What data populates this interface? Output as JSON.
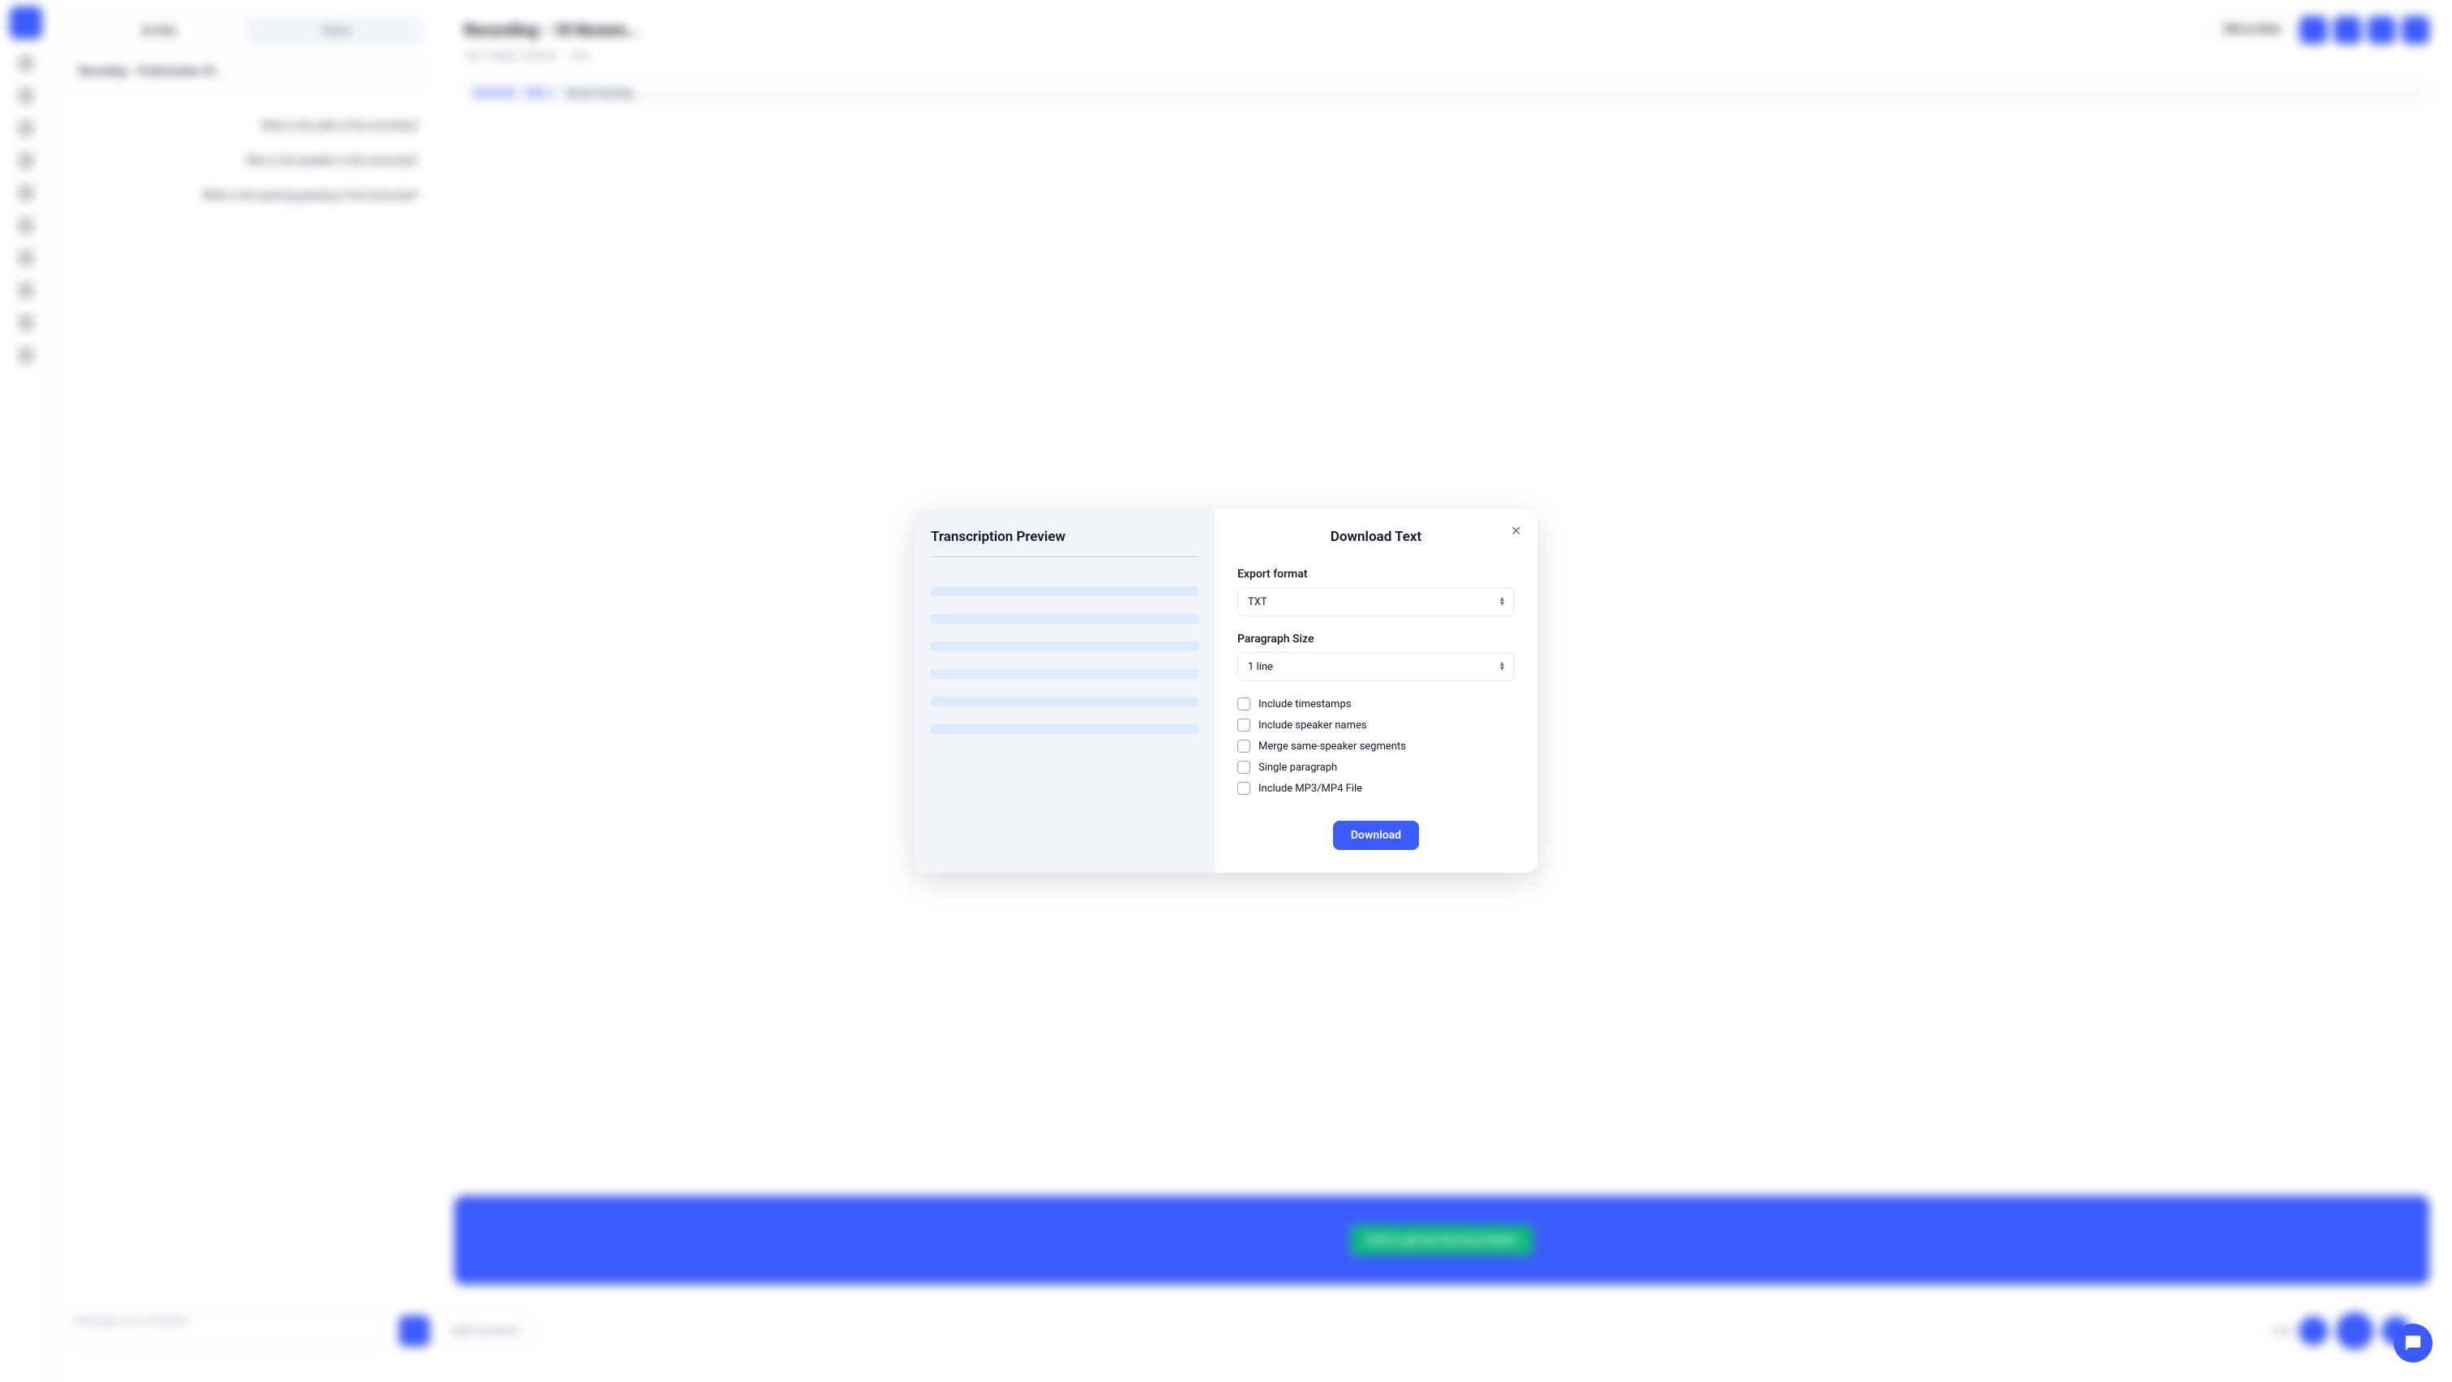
{
  "backdrop": {
    "tabs": [
      "AI Chat",
      "Notes"
    ],
    "recording_name": "Recording - 18 November 20...",
    "chat_messages": [
      "What is the date of the recording?",
      "Who is the speaker in this transcript?",
      "What is the opening greeting of the transcript?"
    ],
    "recording_title": "Recording - 18 Novem...",
    "meta_date": "18/11/2025, 10:30:18",
    "meta_duration": "0:04",
    "transcript_time": "00:00:00",
    "transcript_speaker": "SPK_1",
    "transcript_text": "Good morning.",
    "edit_note_label": "Edit as Note",
    "banner_btn": "Click to get the full transcription",
    "msg_placeholder": "Message to AI Assistant",
    "add_comment": "Add Comment",
    "time": "0:00",
    "speed": "1x"
  },
  "modal": {
    "preview_title": "Transcription Preview",
    "title": "Download Text",
    "export_format_label": "Export format",
    "export_format_value": "TXT",
    "paragraph_size_label": "Paragraph Size",
    "paragraph_size_value": "1 line",
    "checkboxes": [
      "Include timestamps",
      "Include speaker names",
      "Merge same-speaker segments",
      "Single paragraph",
      "Include MP3/MP4 File"
    ],
    "download_button": "Download"
  }
}
